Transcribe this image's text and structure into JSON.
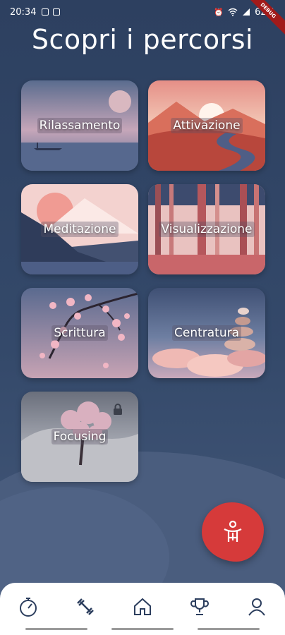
{
  "status_bar": {
    "time": "20:34",
    "battery": "62%"
  },
  "page_title": "Scopri i percorsi",
  "cards": [
    {
      "label": "Rilassamento"
    },
    {
      "label": "Attivazione"
    },
    {
      "label": "Meditazione"
    },
    {
      "label": "Visualizzazione"
    },
    {
      "label": "Scrittura"
    },
    {
      "label": "Centratura"
    },
    {
      "label": "Focusing",
      "locked": true
    }
  ],
  "nav": {
    "items": [
      "timer-icon",
      "dumbbell-icon",
      "home-icon",
      "trophy-icon",
      "profile-icon"
    ]
  },
  "colors": {
    "background": "#2d4060",
    "fab": "#d63a3a",
    "nav_background": "#ffffff"
  }
}
